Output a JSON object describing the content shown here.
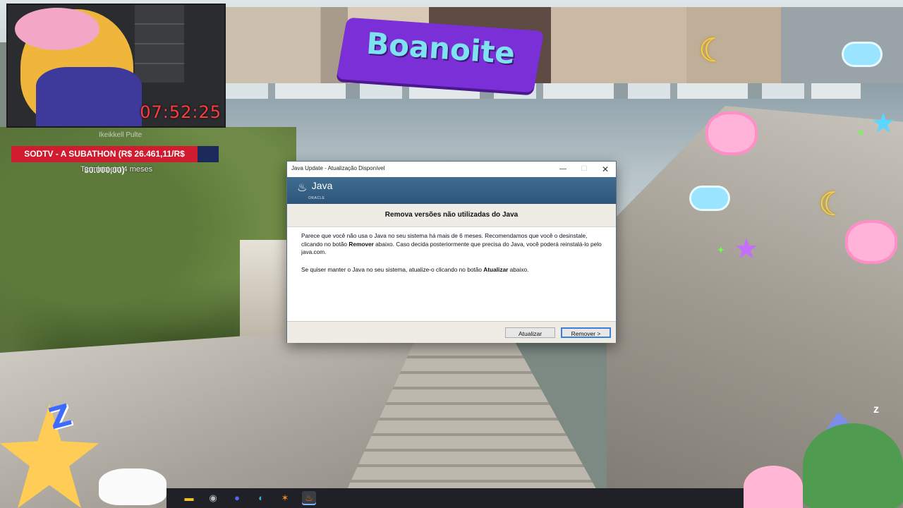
{
  "stream": {
    "timer": "07:52:25",
    "overlay_title": "Boanoite",
    "subathon_label": "SODTV - A SUBATHON (R$ 26.461,11/R$ 30.000,00)",
    "subathon_sub": "Termina em 4 meses",
    "webcam_ghost_text": "Ikeikkell Pulte"
  },
  "dialog": {
    "title": "Java Update - Atualização Disponível",
    "window_controls": {
      "minimize": "—",
      "maximize": "☐",
      "close": "✕"
    },
    "logo_text": "Java",
    "logo_subtext": "ORACLE",
    "heading": "Remova versões não utilizadas do Java",
    "paragraph1_a": "Parece que você não usa o Java no seu sistema há mais de 6 meses. Recomendamos que você o desinstale, clicando no botão ",
    "paragraph1_bold": "Remover",
    "paragraph1_b": " abaixo. Caso decida posteriormente que precisa do Java, você poderá reinstalá-lo pelo java.com.",
    "paragraph2_a": "Se quiser manter o Java no seu sistema, atualize-o clicando no botão ",
    "paragraph2_bold": "Atualizar",
    "paragraph2_b": " abaixo.",
    "update_button": "Atualizar",
    "remove_button": "Remover >"
  },
  "taskbar": {
    "icons": [
      {
        "name": "file-explorer-icon",
        "glyph": "▬",
        "color": "#f2c12e"
      },
      {
        "name": "chat-icon",
        "glyph": "◉",
        "color": "#b9b9b9"
      },
      {
        "name": "discord-icon",
        "glyph": "●",
        "color": "#5865f2"
      },
      {
        "name": "edge-icon",
        "glyph": "◐",
        "color": "#2fb3d9"
      },
      {
        "name": "orange-app-icon",
        "glyph": "✶",
        "color": "#f08a24"
      },
      {
        "name": "java-update-icon",
        "glyph": "♨",
        "color": "#e76f00"
      }
    ]
  },
  "colors": {
    "subathon_red": "#cf1c2e",
    "java_banner": "#3f6c91",
    "timer_red": "#ff3b3b"
  }
}
